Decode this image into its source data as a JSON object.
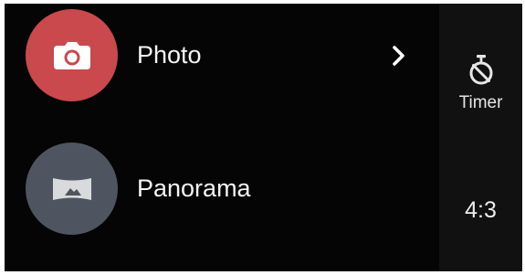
{
  "modes": [
    {
      "label": "Photo",
      "icon": "camera-icon",
      "color": "#c9494c"
    },
    {
      "label": "Panorama",
      "icon": "panorama-icon",
      "color": "#4f5560"
    }
  ],
  "photo_chevron_icon": "chevron-right-icon",
  "side_panel": {
    "timer": {
      "label": "Timer",
      "icon": "timer-icon"
    },
    "aspect_ratio": {
      "label": "4:3"
    }
  },
  "colors": {
    "background": "#050505",
    "side_panel": "#111112",
    "text": "#f4f4f4"
  }
}
